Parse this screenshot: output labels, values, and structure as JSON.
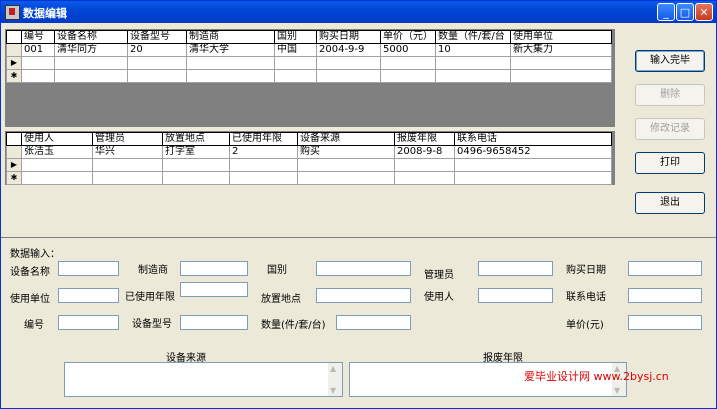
{
  "window": {
    "title": "数据编辑"
  },
  "grid1": {
    "columns": [
      "编号",
      "设备名称",
      "设备型号",
      "制造商",
      "国别",
      "购买日期",
      "单价（元）",
      "数量（件/套/台",
      "使用单位"
    ],
    "rows": [
      [
        "001",
        "清华同方",
        "20",
        "清华大学",
        "中国",
        "2004-9-9",
        "5000",
        "10",
        "新大集力"
      ]
    ]
  },
  "grid2": {
    "columns": [
      "使用人",
      "管理员",
      "放置地点",
      "已使用年限",
      "设备来源",
      "报废年限",
      "联系电话"
    ],
    "rows": [
      [
        "张洁玉",
        "华兴",
        "打字室",
        "2",
        "购买",
        "2008-9-8",
        "0496-9658452"
      ]
    ]
  },
  "buttons": {
    "finish": "输入完毕",
    "delete": "删除",
    "modify": "修改记录",
    "print": "打印",
    "exit": "退出"
  },
  "form": {
    "section": "数据输入：",
    "device_name": "设备名称",
    "manufacturer": "制造商",
    "country": "国别",
    "manager": "管理员",
    "purchase_date": "购买日期",
    "user_unit": "使用单位",
    "years_used": "已使用年限",
    "location": "放置地点",
    "user": "使用人",
    "phone": "联系电话",
    "number": "编号",
    "model": "设备型号",
    "quantity": "数量(件/套/台)",
    "price": "单价(元)",
    "source": "设备来源",
    "scrap_years": "报废年限"
  },
  "watermark": "爱毕业设计网 www.2bysj.cn"
}
